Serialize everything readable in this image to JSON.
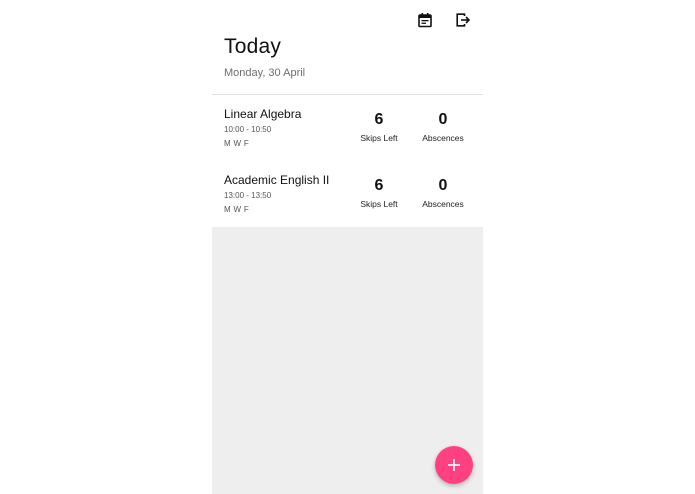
{
  "header": {
    "title": "Today",
    "date": "Monday, 30 April",
    "icons": [
      "calendar-icon",
      "logout-icon"
    ]
  },
  "courses": [
    {
      "name": "Linear Algebra",
      "time": "10:00 - 10:50",
      "days": "M W F",
      "skips_left": "6",
      "skips_label": "Skips Left",
      "absences": "0",
      "absences_label": "Abscences"
    },
    {
      "name": "Academic English II",
      "time": "13:00 - 13:50",
      "days": "M W F",
      "skips_left": "6",
      "skips_label": "Skips Left",
      "absences": "0",
      "absences_label": "Abscences"
    }
  ],
  "fab": {
    "icon": "plus-icon"
  },
  "colors": {
    "accent": "#ff4181",
    "empty_background": "#eeeeee",
    "divider": "#e2e2e2"
  }
}
